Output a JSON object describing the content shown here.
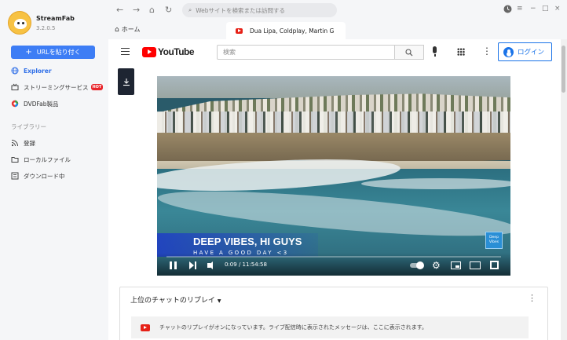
{
  "app": {
    "name": "StreamFab",
    "version": "3.2.0.5"
  },
  "sidebar": {
    "url_button": "URLを貼り付く",
    "items": [
      {
        "label": "Explorer",
        "icon": "globe-icon",
        "active": true
      },
      {
        "label": "ストリーミングサービス",
        "icon": "streaming-icon",
        "badge": "HOT"
      },
      {
        "label": "DVDFab製品",
        "icon": "dvdfab-icon"
      }
    ],
    "library_title": "ライブラリー",
    "library_items": [
      {
        "label": "登録",
        "icon": "rss-icon"
      },
      {
        "label": "ローカルファイル",
        "icon": "folder-icon"
      },
      {
        "label": "ダウンロード中",
        "icon": "download-list-icon"
      }
    ]
  },
  "browser": {
    "address_placeholder": "Webサイトを検索または訪問する",
    "tabs": [
      {
        "label": "ホーム"
      },
      {
        "label": "Dua Lipa, Coldplay, Martin G"
      }
    ]
  },
  "youtube": {
    "logo_text": "YouTube",
    "search_placeholder": "検索",
    "login_label": "ログイン",
    "video": {
      "title_overlay": "DEEP VIBES, HI GUYS",
      "subtitle_overlay": "HAVE A GOOD DAY <3",
      "badge": "Deep Vibes",
      "time": "0:09 / 11:54:58"
    },
    "chat": {
      "header": "上位のチャットのリプレイ",
      "message": "チャットのリプレイがオンになっています。ライブ配信時に表示されたメッセージは、ここに表示されます。"
    }
  },
  "colors": {
    "accent": "#3d7df5",
    "youtube_red": "#ff0000",
    "hot": "#e8262b",
    "login_blue": "#1a73e8"
  }
}
